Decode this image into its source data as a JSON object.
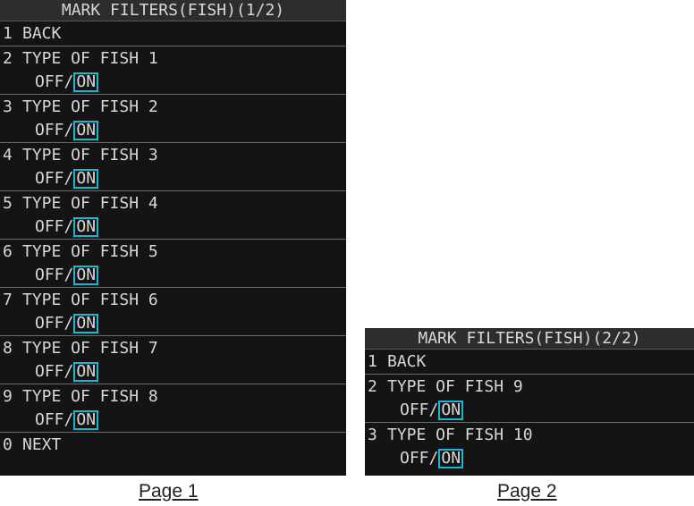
{
  "page1": {
    "title": "MARK FILTERS(FISH)(1/2)",
    "items": [
      {
        "num": "1",
        "label": "BACK"
      },
      {
        "num": "2",
        "label": "TYPE OF FISH 1",
        "off": "OFF/",
        "on": "ON"
      },
      {
        "num": "3",
        "label": "TYPE OF FISH 2",
        "off": "OFF/",
        "on": "ON"
      },
      {
        "num": "4",
        "label": "TYPE OF FISH 3",
        "off": "OFF/",
        "on": "ON"
      },
      {
        "num": "5",
        "label": "TYPE OF FISH 4",
        "off": "OFF/",
        "on": "ON"
      },
      {
        "num": "6",
        "label": "TYPE OF FISH 5",
        "off": "OFF/",
        "on": "ON"
      },
      {
        "num": "7",
        "label": "TYPE OF FISH 6",
        "off": "OFF/",
        "on": "ON"
      },
      {
        "num": "8",
        "label": "TYPE OF FISH 7",
        "off": "OFF/",
        "on": "ON"
      },
      {
        "num": "9",
        "label": "TYPE OF FISH 8",
        "off": "OFF/",
        "on": "ON"
      },
      {
        "num": "0",
        "label": "NEXT"
      }
    ],
    "caption": "Page 1"
  },
  "page2": {
    "title": "MARK FILTERS(FISH)(2/2)",
    "items": [
      {
        "num": "1",
        "label": "BACK"
      },
      {
        "num": "2",
        "label": "TYPE OF FISH 9",
        "off": "OFF/",
        "on": "ON"
      },
      {
        "num": "3",
        "label": "TYPE OF FISH 10",
        "off": "OFF/",
        "on": "ON"
      }
    ],
    "caption": "Page 2"
  },
  "colors": {
    "panel_bg": "#141414",
    "title_bg": "#2d2d2d",
    "text": "#d7d7d7",
    "selection_frame": "#19b7d6"
  }
}
